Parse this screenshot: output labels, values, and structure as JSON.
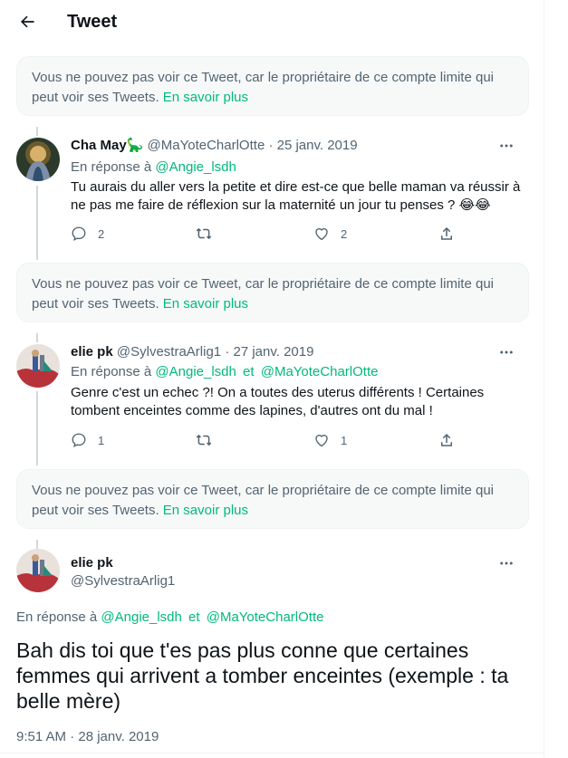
{
  "header": {
    "title": "Tweet",
    "back_icon": "arrow-left-icon"
  },
  "notice": {
    "text": "Vous ne pouvez pas voir ce Tweet, car le propriétaire de ce compte limite qui peut voir ses Tweets.",
    "link": "En savoir plus"
  },
  "tweets": [
    {
      "name": "Cha May🦕",
      "handle": "@MaYoteCharlOtte",
      "date": "25 janv. 2019",
      "reply_prefix": "En réponse à",
      "mentions": [
        "@Angie_lsdh"
      ],
      "text": "Tu aurais du aller vers la petite et dire est-ce que belle maman va réussir à ne pas me faire de réflexion sur la maternité un jour  tu penses ? 😂😂",
      "replies": "2",
      "retweets": "",
      "likes": "2"
    },
    {
      "name": "elie pk",
      "handle": "@SylvestraArlig1",
      "date": "27 janv. 2019",
      "reply_prefix": "En réponse à",
      "mentions": [
        "@Angie_lsdh",
        "@MaYoteCharlOtte"
      ],
      "joiner": "et",
      "text": "Genre c'est un echec ?! On a toutes des uterus différents ! Certaines tombent enceintes comme des lapines, d'autres ont du mal !",
      "replies": "1",
      "retweets": "",
      "likes": "1"
    }
  ],
  "main_tweet": {
    "name": "elie pk",
    "handle": "@SylvestraArlig1",
    "reply_prefix": "En réponse à",
    "mentions": [
      "@Angie_lsdh",
      "@MaYoteCharlOtte"
    ],
    "joiner": "et",
    "text": "Bah dis toi que t'es pas plus conne  que certaines femmes qui arrivent a tomber enceintes (exemple : ta belle mère)",
    "timestamp": "9:51 AM · 28 janv. 2019"
  },
  "colors": {
    "accent": "#00ba7c",
    "muted": "#536471",
    "notice_bg": "#f7f9f9"
  }
}
